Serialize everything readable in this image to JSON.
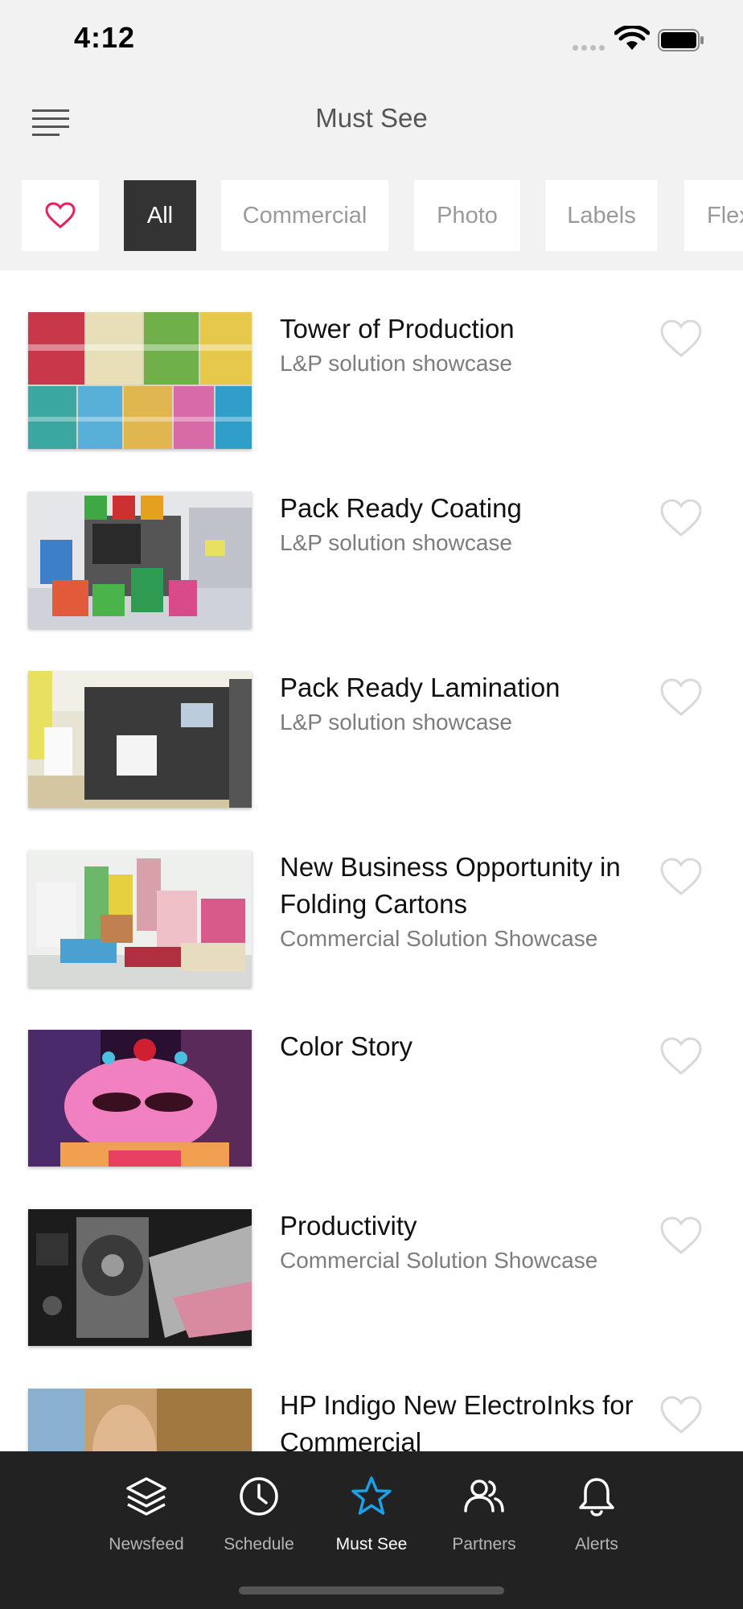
{
  "status": {
    "time": "4:12"
  },
  "header": {
    "title": "Must See"
  },
  "filters": {
    "chips": [
      "All",
      "Commercial",
      "Photo",
      "Labels",
      "Flex"
    ],
    "active": "All"
  },
  "items": [
    {
      "title": "Tower of Production",
      "subtitle": "L&P solution showcase"
    },
    {
      "title": "Pack Ready Coating",
      "subtitle": "L&P solution showcase"
    },
    {
      "title": "Pack Ready Lamination",
      "subtitle": "L&P solution showcase"
    },
    {
      "title": "New Business Opportunity in Folding Cartons",
      "subtitle": "Commercial Solution Showcase"
    },
    {
      "title": "Color Story",
      "subtitle": ""
    },
    {
      "title": "Productivity",
      "subtitle": "Commercial Solution Showcase"
    },
    {
      "title": "HP Indigo New ElectroInks for Commercial",
      "subtitle": ""
    }
  ],
  "tabs": [
    {
      "label": "Newsfeed",
      "icon": "layers-icon"
    },
    {
      "label": "Schedule",
      "icon": "clock-icon"
    },
    {
      "label": "Must See",
      "icon": "star-icon"
    },
    {
      "label": "Partners",
      "icon": "people-icon"
    },
    {
      "label": "Alerts",
      "icon": "bell-icon"
    }
  ],
  "colors": {
    "accent": "#1ea0e8",
    "favorite": "#e0245e",
    "tabbar": "#222222",
    "active_chip": "#333333"
  }
}
